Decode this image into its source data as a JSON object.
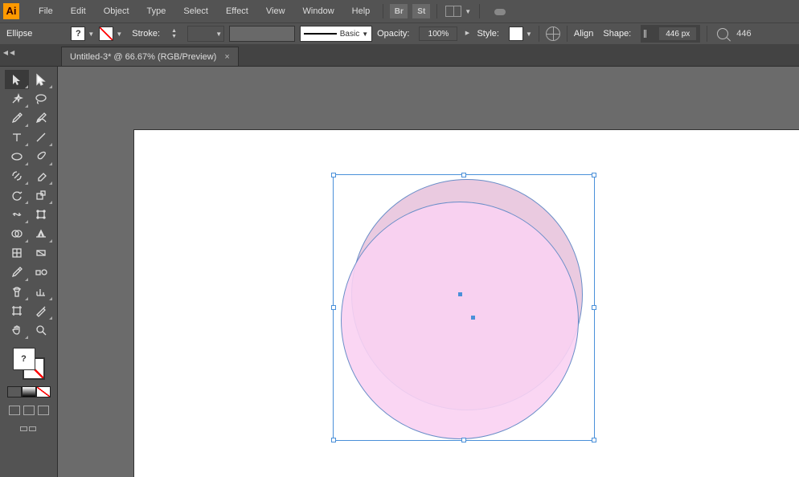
{
  "app": {
    "logo_text": "Ai"
  },
  "menu": {
    "items": [
      "File",
      "Edit",
      "Object",
      "Type",
      "Select",
      "Effect",
      "View",
      "Window",
      "Help"
    ]
  },
  "bridge_btn": "Br",
  "stock_btn": "St",
  "control": {
    "selection": "Ellipse",
    "stroke_label": "Stroke:",
    "brush_label": "Basic",
    "opacity_label": "Opacity:",
    "opacity_value": "100%",
    "style_label": "Style:",
    "align_label": "Align",
    "shape_label": "Shape:",
    "shape_width": "446 px",
    "shape_width2": "446"
  },
  "tab": {
    "title": "Untitled-3* @ 66.67% (RGB/Preview)"
  },
  "tools": {
    "fill_q": "?"
  },
  "canvas": {
    "sel_w": 326,
    "sel_h": 332
  }
}
